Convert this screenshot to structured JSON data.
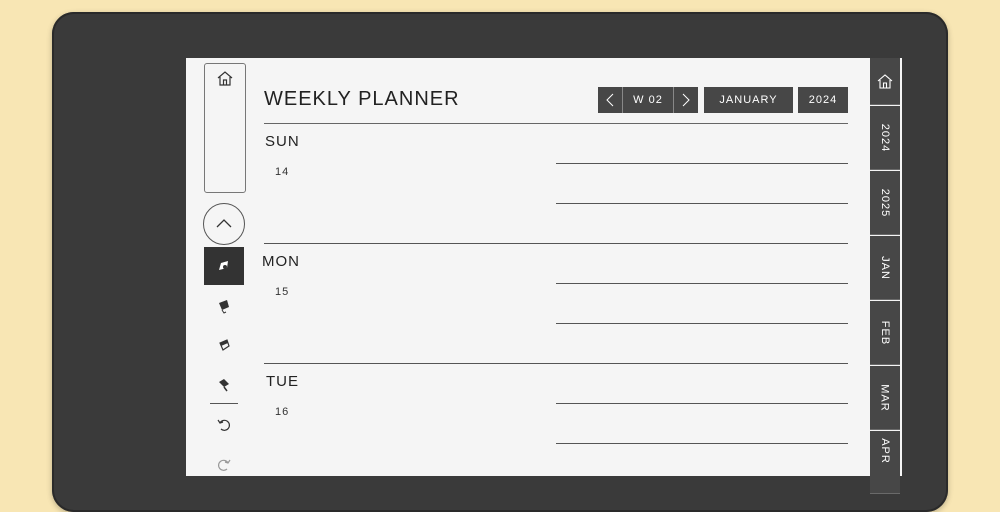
{
  "planner": {
    "title": "WEEKLY PLANNER",
    "nav": {
      "prev_icon": "chevron-left-icon",
      "week": "W 02",
      "next_icon": "chevron-right-icon",
      "month": "JANUARY",
      "year": "2024"
    },
    "days": [
      {
        "label": "SUN",
        "date": "14"
      },
      {
        "label": "MON",
        "date": "15"
      },
      {
        "label": "TUE",
        "date": "16"
      }
    ]
  },
  "toolbar": {
    "home_icon": "home-icon",
    "up_icon": "chevron-up-icon",
    "tools": [
      "pen-icon",
      "highlighter-icon",
      "eraser-icon",
      "lasso-icon",
      "undo-icon",
      "redo-icon"
    ]
  },
  "side_tabs": {
    "home_icon": "home-icon",
    "items": [
      "2024",
      "2025",
      "JAN",
      "FEB",
      "MAR",
      "APR"
    ]
  },
  "colors": {
    "background": "#f8e6b4",
    "device": "#3a3a3a",
    "screen": "#f5f5f5",
    "button": "#474747"
  }
}
